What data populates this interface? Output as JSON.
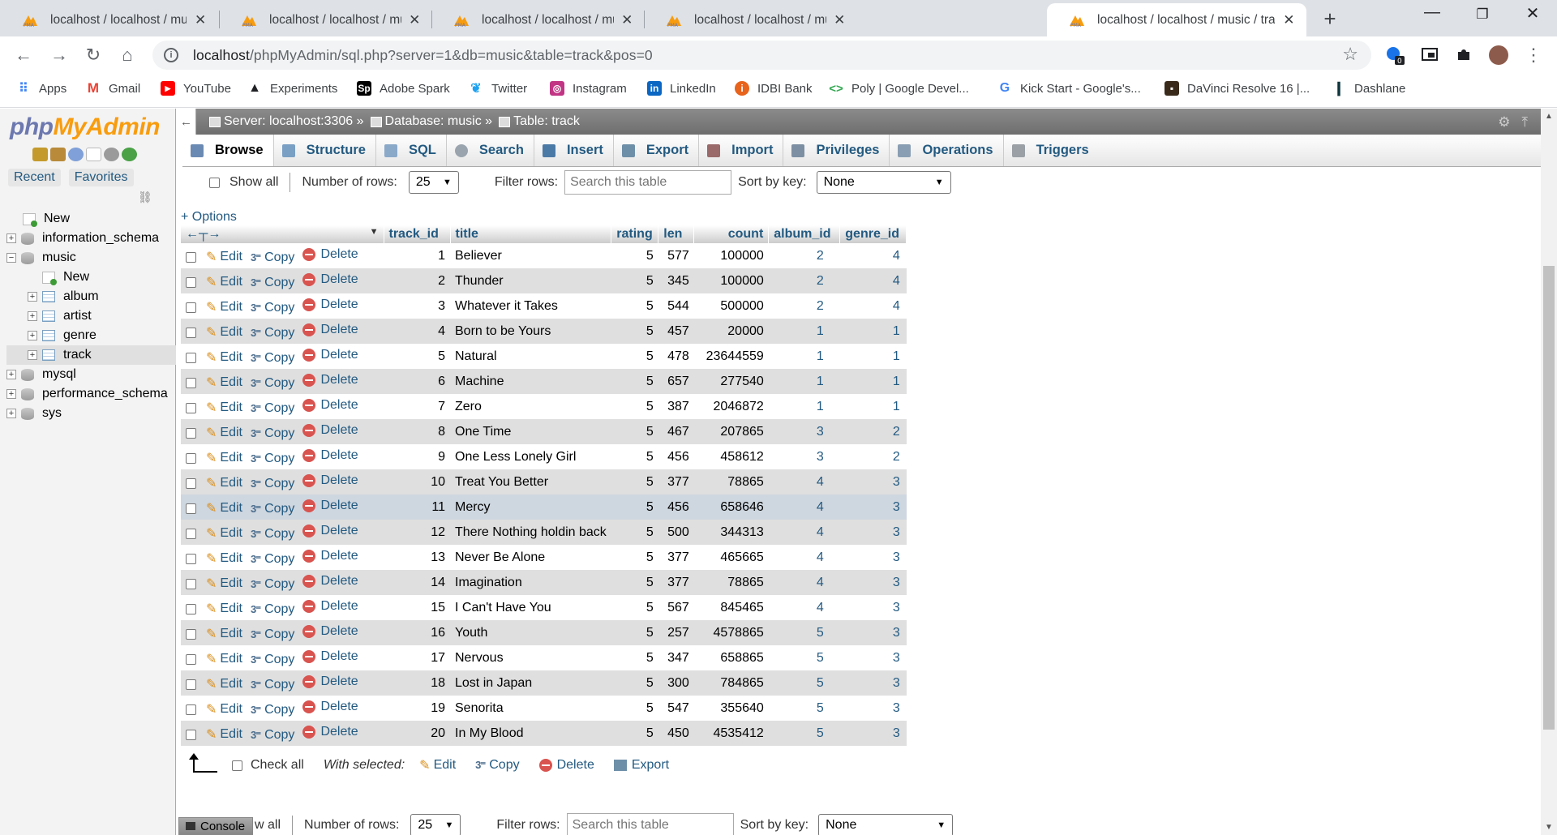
{
  "browser": {
    "tabs": [
      {
        "title": "localhost / localhost / music | phpM",
        "active": false
      },
      {
        "title": "localhost / localhost / music / artist",
        "active": false
      },
      {
        "title": "localhost / localhost / music / genre",
        "active": false
      },
      {
        "title": "localhost / localhost / music / album",
        "active": false
      },
      {
        "title": "localhost / localhost / music / track |",
        "active": true
      }
    ],
    "url_host": "localhost",
    "url_path": "/phpMyAdmin/sql.php?server=1&db=music&table=track&pos=0",
    "extension_badge": "0",
    "bookmarks": [
      {
        "label": "Apps",
        "icon": "apps-grid-icon",
        "color": "#4285f4"
      },
      {
        "label": "Gmail",
        "icon": "gmail-icon",
        "color": "#ea4335"
      },
      {
        "label": "YouTube",
        "icon": "youtube-icon",
        "color": "#ff0000"
      },
      {
        "label": "Experiments",
        "icon": "flask-icon",
        "color": "#202124"
      },
      {
        "label": "Adobe Spark",
        "icon": "adobe-spark-icon",
        "color": "#000000"
      },
      {
        "label": "Twitter",
        "icon": "twitter-icon",
        "color": "#1da1f2"
      },
      {
        "label": "Instagram",
        "icon": "instagram-icon",
        "color": "#c13584"
      },
      {
        "label": "LinkedIn",
        "icon": "linkedin-icon",
        "color": "#0a66c2"
      },
      {
        "label": "IDBI Bank",
        "icon": "idbi-icon",
        "color": "#e8631c"
      },
      {
        "label": "Poly | Google Devel...",
        "icon": "poly-icon",
        "color": "#34a853"
      },
      {
        "label": "Kick Start - Google's...",
        "icon": "google-icon",
        "color": "#4285f4"
      },
      {
        "label": "DaVinci Resolve 16 |...",
        "icon": "davinci-icon",
        "color": "#3a2a1a"
      },
      {
        "label": "Dashlane",
        "icon": "dashlane-icon",
        "color": "#0e353d"
      }
    ]
  },
  "pma": {
    "logo": {
      "php": "php",
      "my": "My",
      "admin": "Admin"
    },
    "nav_links": [
      "Recent",
      "Favorites"
    ],
    "tree": [
      {
        "label": "New",
        "kind": "new",
        "level": 0
      },
      {
        "label": "information_schema",
        "kind": "db",
        "level": 0,
        "expander": "+"
      },
      {
        "label": "music",
        "kind": "db",
        "level": 0,
        "expander": "−"
      },
      {
        "label": "New",
        "kind": "new",
        "level": 1
      },
      {
        "label": "album",
        "kind": "table",
        "level": 1,
        "expander": "+"
      },
      {
        "label": "artist",
        "kind": "table",
        "level": 1,
        "expander": "+"
      },
      {
        "label": "genre",
        "kind": "table",
        "level": 1,
        "expander": "+"
      },
      {
        "label": "track",
        "kind": "table",
        "level": 1,
        "expander": "+",
        "selected": true
      },
      {
        "label": "mysql",
        "kind": "db",
        "level": 0,
        "expander": "+"
      },
      {
        "label": "performance_schema",
        "kind": "db",
        "level": 0,
        "expander": "+"
      },
      {
        "label": "sys",
        "kind": "db",
        "level": 0,
        "expander": "+"
      }
    ],
    "breadcrumb": {
      "server": "Server: localhost:3306 »",
      "database": "Database: music »",
      "table": "Table: track"
    },
    "tabs": [
      {
        "label": "Browse",
        "icon": "browse-icon",
        "color": "#6b8ab3"
      },
      {
        "label": "Structure",
        "icon": "structure-icon",
        "color": "#7aa0c4"
      },
      {
        "label": "SQL",
        "icon": "sql-icon",
        "color": "#8aa9c9"
      },
      {
        "label": "Search",
        "icon": "search-icon",
        "color": "#9aa4ae"
      },
      {
        "label": "Insert",
        "icon": "insert-icon",
        "color": "#4c7aa6"
      },
      {
        "label": "Export",
        "icon": "export-icon",
        "color": "#6e8fa8"
      },
      {
        "label": "Import",
        "icon": "import-icon",
        "color": "#9a6a6a"
      },
      {
        "label": "Privileges",
        "icon": "privileges-icon",
        "color": "#7d8fa3"
      },
      {
        "label": "Operations",
        "icon": "operations-icon",
        "color": "#8a9eb3"
      },
      {
        "label": "Triggers",
        "icon": "triggers-icon",
        "color": "#9aa0a6"
      }
    ],
    "navbar": {
      "show_all": "Show all",
      "num_rows_label": "Number of rows:",
      "num_rows_value": "25",
      "filter_label": "Filter rows:",
      "filter_placeholder": "Search this table",
      "sort_label": "Sort by key:",
      "sort_value": "None"
    },
    "options_link": "+ Options",
    "columns": [
      "track_id",
      "title",
      "rating",
      "len",
      "count",
      "album_id",
      "genre_id"
    ],
    "row_actions": {
      "edit": "Edit",
      "copy": "Copy",
      "delete": "Delete"
    },
    "rows": [
      [
        "1",
        "Believer",
        "5",
        "577",
        "100000",
        "2",
        "4"
      ],
      [
        "2",
        "Thunder",
        "5",
        "345",
        "100000",
        "2",
        "4"
      ],
      [
        "3",
        "Whatever it Takes",
        "5",
        "544",
        "500000",
        "2",
        "4"
      ],
      [
        "4",
        "Born to be Yours",
        "5",
        "457",
        "20000",
        "1",
        "1"
      ],
      [
        "5",
        "Natural",
        "5",
        "478",
        "23644559",
        "1",
        "1"
      ],
      [
        "6",
        "Machine",
        "5",
        "657",
        "277540",
        "1",
        "1"
      ],
      [
        "7",
        "Zero",
        "5",
        "387",
        "2046872",
        "1",
        "1"
      ],
      [
        "8",
        "One Time",
        "5",
        "467",
        "207865",
        "3",
        "2"
      ],
      [
        "9",
        "One Less Lonely Girl",
        "5",
        "456",
        "458612",
        "3",
        "2"
      ],
      [
        "10",
        "Treat You Better",
        "5",
        "377",
        "78865",
        "4",
        "3"
      ],
      [
        "11",
        "Mercy",
        "5",
        "456",
        "658646",
        "4",
        "3"
      ],
      [
        "12",
        "There Nothing holdin back",
        "5",
        "500",
        "344313",
        "4",
        "3"
      ],
      [
        "13",
        "Never Be Alone",
        "5",
        "377",
        "465665",
        "4",
        "3"
      ],
      [
        "14",
        "Imagination",
        "5",
        "377",
        "78865",
        "4",
        "3"
      ],
      [
        "15",
        "I Can't Have You",
        "5",
        "567",
        "845465",
        "4",
        "3"
      ],
      [
        "16",
        "Youth",
        "5",
        "257",
        "4578865",
        "5",
        "3"
      ],
      [
        "17",
        "Nervous",
        "5",
        "347",
        "658865",
        "5",
        "3"
      ],
      [
        "18",
        "Lost in Japan",
        "5",
        "300",
        "784865",
        "5",
        "3"
      ],
      [
        "19",
        "Senorita",
        "5",
        "547",
        "355640",
        "5",
        "3"
      ],
      [
        "20",
        "In My Blood",
        "5",
        "450",
        "4535412",
        "5",
        "3"
      ]
    ],
    "hovered_row_index": 10,
    "bulk": {
      "check_all": "Check all",
      "with_selected": "With selected:",
      "edit": "Edit",
      "copy": "Copy",
      "delete": "Delete",
      "export": "Export"
    },
    "bottom_navbar_show_all": "w all",
    "console": "Console"
  }
}
